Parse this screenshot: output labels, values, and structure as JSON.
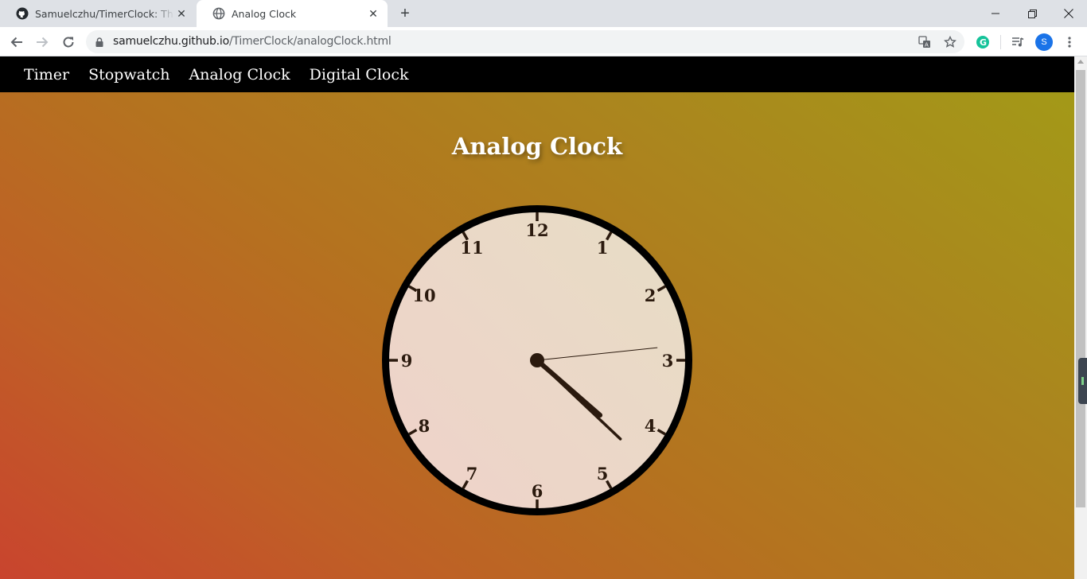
{
  "browser": {
    "tabs": [
      {
        "title": "Samuelczhu/TimerClock: This w",
        "icon": "github-icon"
      },
      {
        "title": "Analog Clock",
        "icon": "globe-icon"
      }
    ],
    "url_host": "samuelczhu.github.io",
    "url_path": "/TimerClock/analogClock.html",
    "profile_initial": "S"
  },
  "nav": {
    "items": [
      "Timer",
      "Stopwatch",
      "Analog Clock",
      "Digital Clock"
    ]
  },
  "page": {
    "heading": "Analog Clock"
  },
  "clock": {
    "numerals": [
      "12",
      "1",
      "2",
      "3",
      "4",
      "5",
      "6",
      "7",
      "8",
      "9",
      "10",
      "11"
    ],
    "time": {
      "hours": 4,
      "minutes": 22,
      "seconds": 14
    },
    "face_colors": {
      "top_right": "#e7ddc5",
      "bottom_left": "#efd2ca"
    },
    "rim_color": "#000000",
    "hand_color": "#2b1a0e"
  },
  "colors": {
    "gradient_start": "#c9442e",
    "gradient_end": "#a29b17",
    "navbar": "#000000"
  }
}
